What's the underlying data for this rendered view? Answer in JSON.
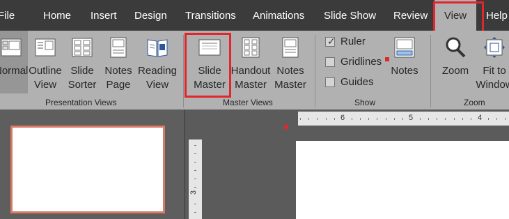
{
  "tabs": [
    {
      "label": "File"
    },
    {
      "label": "Home"
    },
    {
      "label": "Insert"
    },
    {
      "label": "Design"
    },
    {
      "label": "Transitions"
    },
    {
      "label": "Animations"
    },
    {
      "label": "Slide Show"
    },
    {
      "label": "Review"
    },
    {
      "label": "View",
      "active": true
    },
    {
      "label": "Help"
    }
  ],
  "ribbon": {
    "presentation_views": {
      "label": "Presentation Views",
      "buttons": [
        {
          "line1": "Normal",
          "line2": ""
        },
        {
          "line1": "Outline",
          "line2": "View"
        },
        {
          "line1": "Slide",
          "line2": "Sorter"
        },
        {
          "line1": "Notes",
          "line2": "Page"
        },
        {
          "line1": "Reading",
          "line2": "View"
        }
      ]
    },
    "master_views": {
      "label": "Master Views",
      "buttons": [
        {
          "line1": "Slide",
          "line2": "Master"
        },
        {
          "line1": "Handout",
          "line2": "Master"
        },
        {
          "line1": "Notes",
          "line2": "Master"
        }
      ]
    },
    "show": {
      "label": "Show",
      "checkboxes": [
        {
          "label": "Ruler",
          "checked": true
        },
        {
          "label": "Gridlines",
          "checked": false
        },
        {
          "label": "Guides",
          "checked": false
        }
      ],
      "notes_button": "Notes"
    },
    "zoom": {
      "label": "Zoom",
      "buttons": [
        {
          "line1": "Zoom",
          "line2": ""
        },
        {
          "line1": "Fit to",
          "line2": "Window"
        }
      ]
    }
  },
  "ruler": {
    "horizontal_numbers": [
      "6",
      "5",
      "4"
    ],
    "vertical_numbers": [
      "3"
    ]
  },
  "colors": {
    "tab_bar": "#3b3b3b",
    "ribbon": "#b1b1b1",
    "highlight": "#e1262d",
    "thumbnail_border": "#d97a66"
  }
}
